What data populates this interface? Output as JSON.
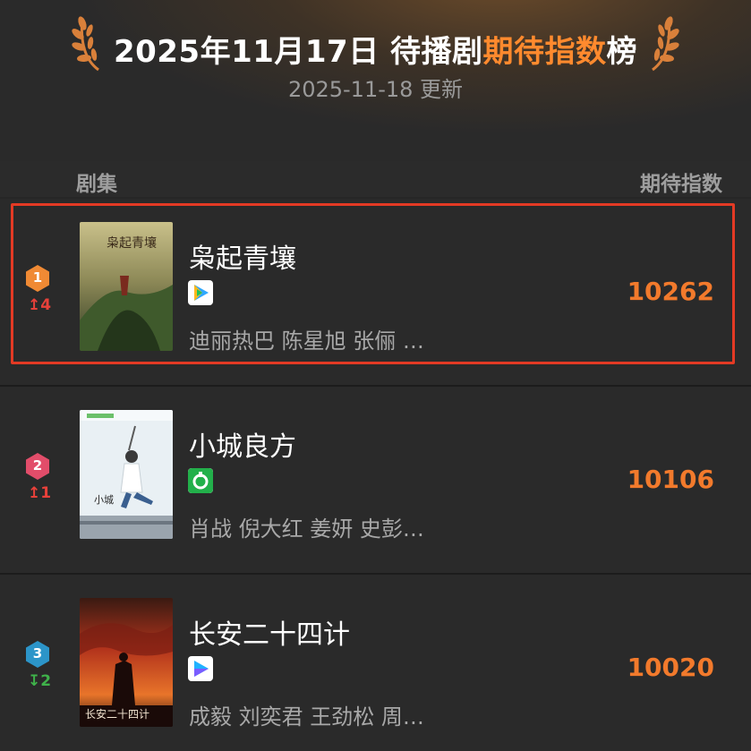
{
  "header": {
    "title_main": "2025年11月17日 待播剧",
    "title_highlight": "期待指数",
    "title_suffix": "榜",
    "update_text": "2025-11-18 更新"
  },
  "columns": {
    "left_label": "剧集",
    "right_label": "期待指数"
  },
  "colors": {
    "accent_orange": "#f27a2c",
    "highlight_border": "#e33a24",
    "rank_up": "#e8413a",
    "rank_down": "#3fb24a"
  },
  "rows": [
    {
      "rank": "1",
      "rank_badge_color": "#f08a34",
      "change": "↥4",
      "change_dir": "up",
      "title": "枭起青壤",
      "platform_icon": "tencent-video-icon",
      "cast": "迪丽热巴 陈星旭 张俪 …",
      "score": "10262",
      "highlighted": true
    },
    {
      "rank": "2",
      "rank_badge_color": "#e24d6a",
      "change": "↥1",
      "change_dir": "up",
      "title": "小城良方",
      "platform_icon": "iqiyi-icon",
      "cast": "肖战 倪大红 姜妍 史彭…",
      "score": "10106",
      "highlighted": false
    },
    {
      "rank": "3",
      "rank_badge_color": "#2c95c9",
      "change": "↧2",
      "change_dir": "down",
      "title": "长安二十四计",
      "platform_icon": "youku-icon",
      "cast": "成毅 刘奕君 王劲松 周…",
      "score": "10020",
      "highlighted": false
    }
  ]
}
